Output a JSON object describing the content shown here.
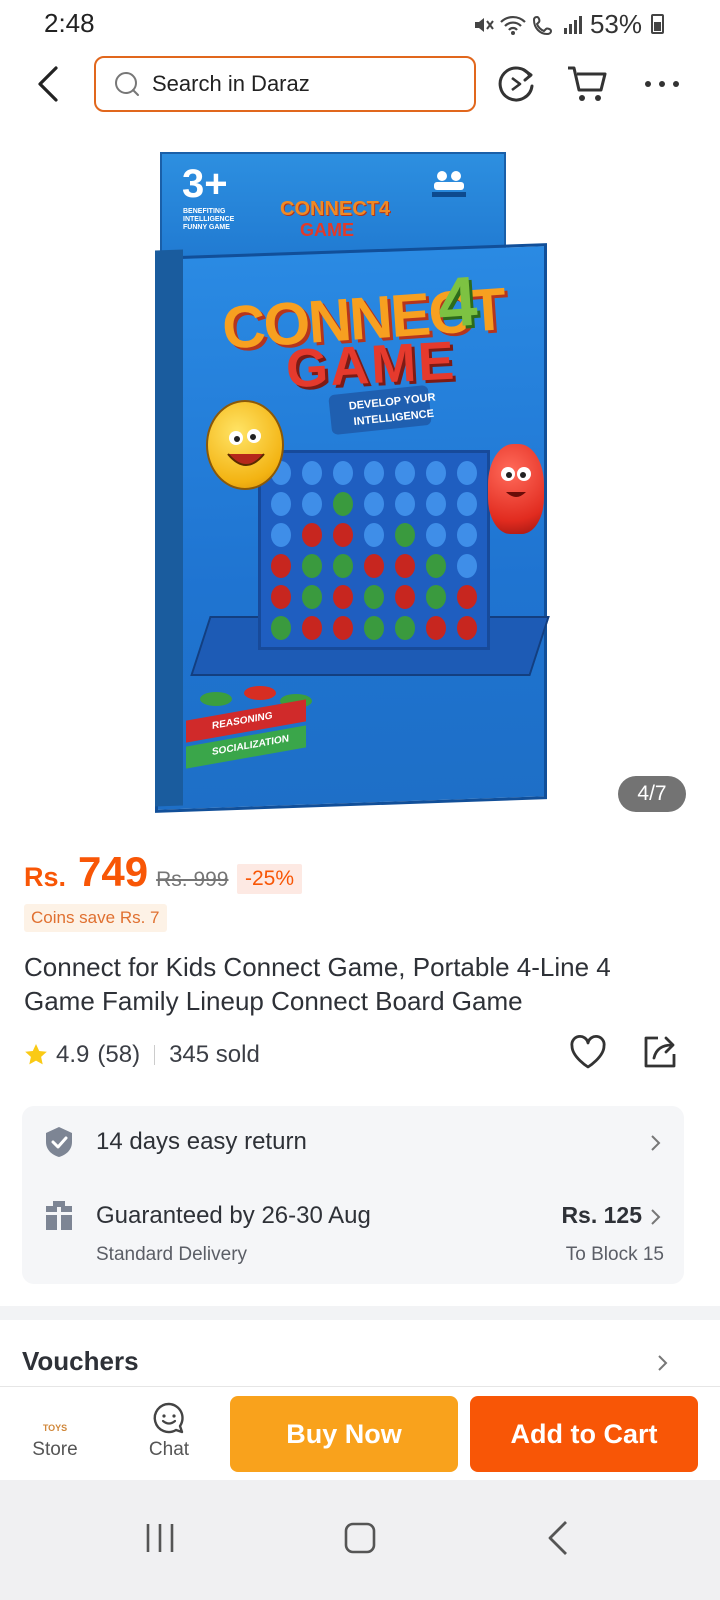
{
  "status_bar": {
    "time": "2:48",
    "battery": "53%"
  },
  "search": {
    "placeholder": "Search in Daraz"
  },
  "product_image": {
    "counter": "4/7",
    "box_texts": {
      "age": "3+",
      "age_sub": "BENEFITING INTELLIGENCE FUNNY GAME",
      "small_logo": "CONNECT4",
      "small_logo_2": "GAME",
      "logo_connect": "CONNECT",
      "logo_4": "4",
      "logo_game": "GAME",
      "tagline": "DEVELOP YOUR INTELLIGENCE",
      "label_red": "REASONING",
      "label_green": "SOCIALIZATION"
    }
  },
  "price": {
    "currency": "Rs.",
    "value": "749",
    "original": "Rs. 999",
    "discount": "-25%",
    "coins": "Coins save Rs. 7",
    "accent_color": "#f85606"
  },
  "product": {
    "title": "Connect for Kids Connect Game, Portable 4-Line 4 Game Family Lineup Connect Board Game",
    "rating": "4.9",
    "reviews": "(58)",
    "sold": "345 sold"
  },
  "delivery": {
    "return_text": "14 days easy return",
    "guarantee_text": "Guaranteed by 26-30 Aug",
    "delivery_type": "Standard Delivery",
    "delivery_price": "Rs. 125",
    "destination": "To Block 15"
  },
  "vouchers": {
    "title": "Vouchers"
  },
  "action_bar": {
    "store_label": "Store",
    "store_logo_text": "TOYS",
    "chat_label": "Chat",
    "buy_now": "Buy Now",
    "add_to_cart": "Add to Cart",
    "buy_color": "#f9a21c",
    "cart_color": "#f85606"
  }
}
